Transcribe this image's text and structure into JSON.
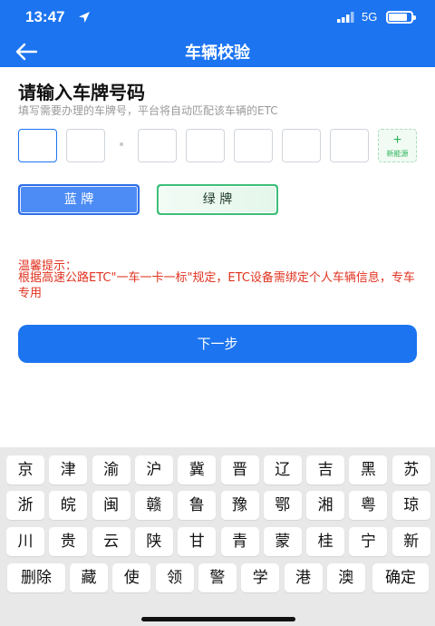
{
  "status_bar": {
    "time": "13:47",
    "network": "5G",
    "battery_level": 0.82,
    "icons": [
      "location-arrow-icon",
      "signal-icon",
      "battery-icon"
    ]
  },
  "nav": {
    "title": "车辆校验",
    "back_icon": "arrow-left-icon",
    "color": "#1c74f0"
  },
  "form": {
    "heading": "请输入车牌号码",
    "hint": "填写需要办理的车牌号，平台将自动匹配该车辆的ETC",
    "plate_cells": 7,
    "new_energy_icon": "plus-icon",
    "new_energy_label": "新能源",
    "plate_types": {
      "blue": "蓝 牌",
      "green": "绿 牌"
    }
  },
  "tips": {
    "title": "温馨提示：",
    "body": "根据高速公路ETC\"一车一卡一标\"规定，ETC设备需绑定个人车辆信息，专车专用",
    "color": "#e0321f"
  },
  "next_button": "下一步",
  "keyboard": {
    "rows": [
      [
        "京",
        "津",
        "渝",
        "沪",
        "冀",
        "晋",
        "辽",
        "吉",
        "黑",
        "苏"
      ],
      [
        "浙",
        "皖",
        "闽",
        "赣",
        "鲁",
        "豫",
        "鄂",
        "湘",
        "粤",
        "琼"
      ],
      [
        "川",
        "贵",
        "云",
        "陕",
        "甘",
        "青",
        "蒙",
        "桂",
        "宁",
        "新"
      ]
    ],
    "last_row": {
      "delete": "删除",
      "keys": [
        "藏",
        "使",
        "领",
        "警",
        "学",
        "港",
        "澳"
      ],
      "confirm": "确定"
    }
  }
}
